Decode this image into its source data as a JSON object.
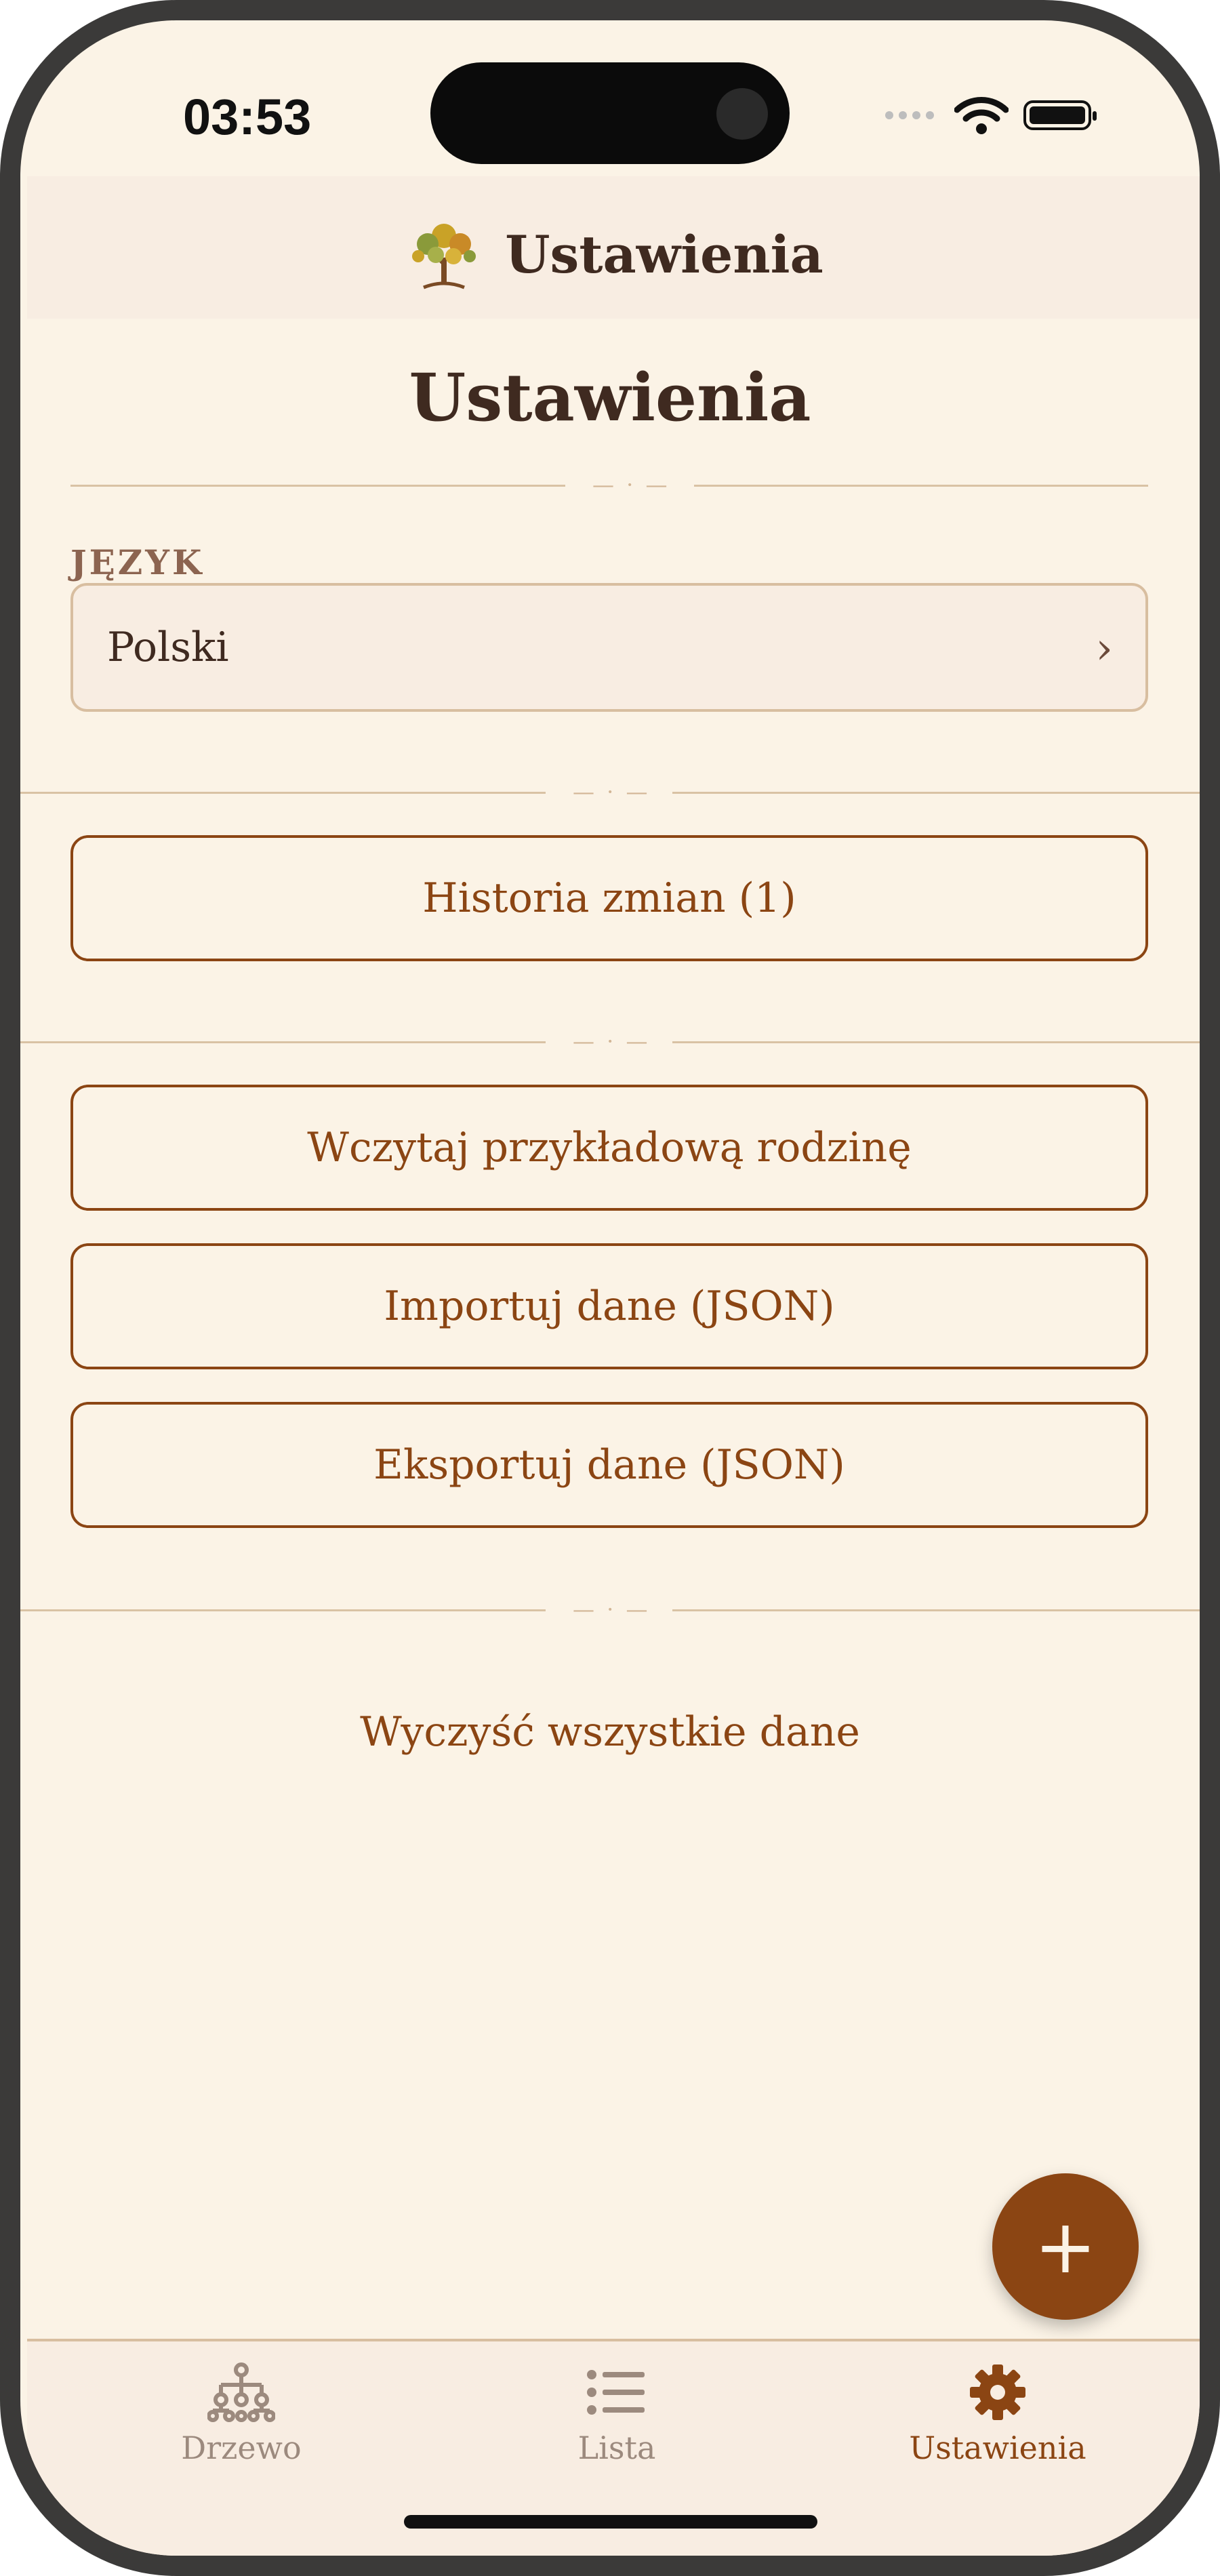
{
  "status_bar": {
    "time": "03:53",
    "icons": [
      "signal-dots-icon",
      "wifi-icon",
      "battery-icon"
    ]
  },
  "app_header": {
    "logo_icon": "tree-logo-icon",
    "title": "Ustawienia"
  },
  "page": {
    "title": "Ustawienia"
  },
  "language": {
    "label": "JĘZYK",
    "selected": "Polski",
    "chevron_icon": "chevron-right-icon"
  },
  "actions": {
    "history": "Historia zmian (1)",
    "load_sample": "Wczytaj przykładową rodzinę",
    "import": "Importuj dane (JSON)",
    "export": "Eksportuj dane (JSON)",
    "clear": "Wyczyść wszystkie dane"
  },
  "fab": {
    "icon": "plus-icon",
    "label": "+"
  },
  "tabs": [
    {
      "label": "Drzewo",
      "icon": "family-tree-icon",
      "active": false
    },
    {
      "label": "Lista",
      "icon": "list-icon",
      "active": false
    },
    {
      "label": "Ustawienia",
      "icon": "gear-icon",
      "active": true
    }
  ],
  "colors": {
    "accent": "#8b4513",
    "background": "#fbf3e6",
    "header_bg": "#f8ede2",
    "border": "#d8bea0",
    "text": "#3f2a20"
  }
}
